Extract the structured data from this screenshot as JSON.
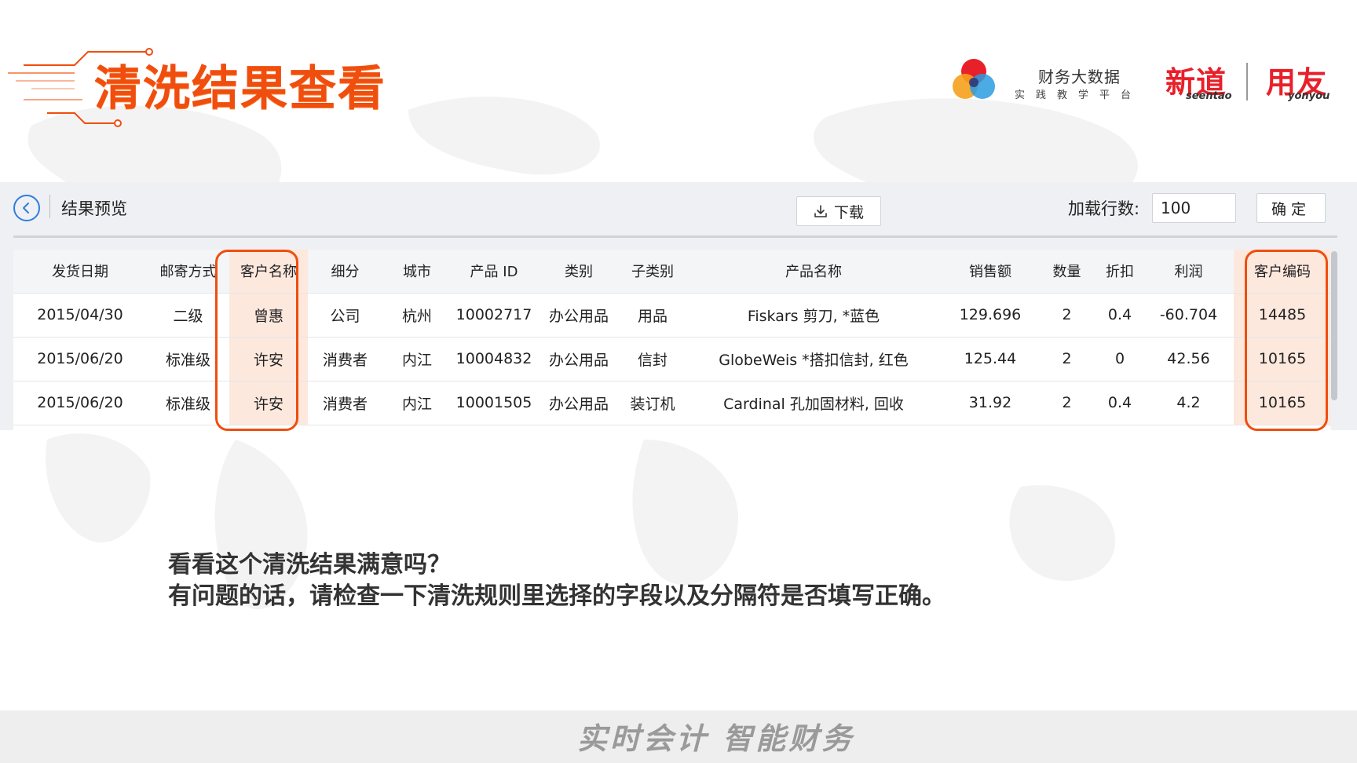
{
  "slide": {
    "title": "清洗结果查看",
    "caption_line1": "看看这个清洗结果满意吗？",
    "caption_line2": "有问题的话，请检查一下清洗规则里选择的字段以及分隔符是否填写正确。",
    "footer": "实时会计 智能财务"
  },
  "brand": {
    "platform_name": "财务大数据",
    "platform_sub": "实践教学平台",
    "seentao_cn": "新道",
    "seentao_en": "seentao",
    "yonyou_cn": "用友",
    "yonyou_en": "yonyou"
  },
  "toolbar": {
    "back_icon": "chevron-left-icon",
    "title": "结果预览",
    "download_label": "下载",
    "download_icon": "download-icon",
    "rows_label": "加载行数:",
    "rows_value": "100",
    "confirm_label": "确定"
  },
  "table": {
    "headers": [
      "发货日期",
      "邮寄方式",
      "客户名称",
      "细分",
      "城市",
      "产品 ID",
      "类别",
      "子类别",
      "产品名称",
      "销售额",
      "数量",
      "折扣",
      "利润",
      "客户编码"
    ],
    "rows": [
      [
        "2015/04/30",
        "二级",
        "曾惠",
        "公司",
        "杭州",
        "10002717",
        "办公用品",
        "用品",
        "Fiskars 剪刀, *蓝色",
        "129.696",
        "2",
        "0.4",
        "-60.704",
        "14485"
      ],
      [
        "2015/06/20",
        "标准级",
        "许安",
        "消费者",
        "内江",
        "10004832",
        "办公用品",
        "信封",
        "GlobeWeis *搭扣信封, 红色",
        "125.44",
        "2",
        "0",
        "42.56",
        "10165"
      ],
      [
        "2015/06/20",
        "标准级",
        "许安",
        "消费者",
        "内江",
        "10001505",
        "办公用品",
        "装订机",
        "Cardinal 孔加固材料, 回收",
        "31.92",
        "2",
        "0.4",
        "4.2",
        "10165"
      ]
    ],
    "highlighted_columns": [
      "客户名称",
      "客户编码"
    ]
  },
  "colors": {
    "accent": "#f04e0e",
    "highlight_fill": "#fde8de",
    "link_blue": "#2f7de1",
    "brand_red": "#e8202a"
  }
}
